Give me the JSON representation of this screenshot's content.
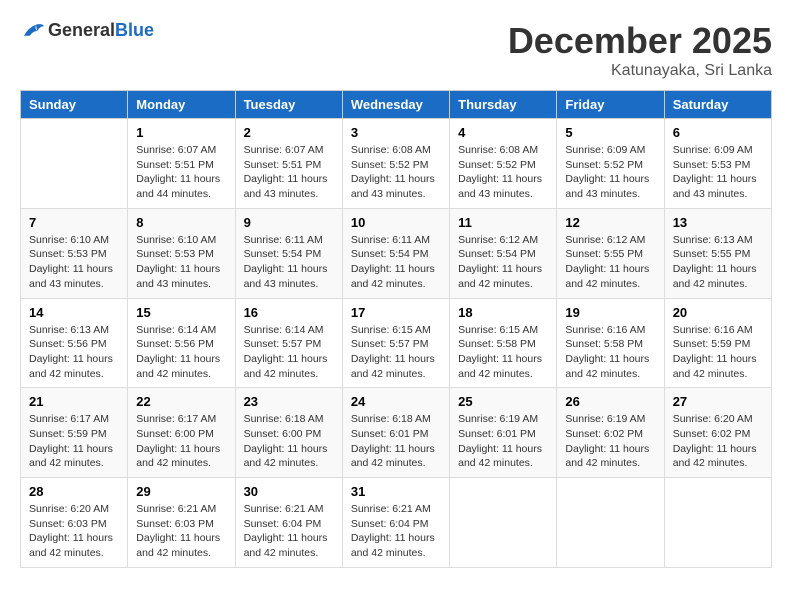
{
  "logo": {
    "general": "General",
    "blue": "Blue"
  },
  "title": "December 2025",
  "location": "Katunayaka, Sri Lanka",
  "weekdays": [
    "Sunday",
    "Monday",
    "Tuesday",
    "Wednesday",
    "Thursday",
    "Friday",
    "Saturday"
  ],
  "weeks": [
    [
      {
        "day": "",
        "info": ""
      },
      {
        "day": "1",
        "info": "Sunrise: 6:07 AM\nSunset: 5:51 PM\nDaylight: 11 hours and 44 minutes."
      },
      {
        "day": "2",
        "info": "Sunrise: 6:07 AM\nSunset: 5:51 PM\nDaylight: 11 hours and 43 minutes."
      },
      {
        "day": "3",
        "info": "Sunrise: 6:08 AM\nSunset: 5:52 PM\nDaylight: 11 hours and 43 minutes."
      },
      {
        "day": "4",
        "info": "Sunrise: 6:08 AM\nSunset: 5:52 PM\nDaylight: 11 hours and 43 minutes."
      },
      {
        "day": "5",
        "info": "Sunrise: 6:09 AM\nSunset: 5:52 PM\nDaylight: 11 hours and 43 minutes."
      },
      {
        "day": "6",
        "info": "Sunrise: 6:09 AM\nSunset: 5:53 PM\nDaylight: 11 hours and 43 minutes."
      }
    ],
    [
      {
        "day": "7",
        "info": "Sunrise: 6:10 AM\nSunset: 5:53 PM\nDaylight: 11 hours and 43 minutes."
      },
      {
        "day": "8",
        "info": "Sunrise: 6:10 AM\nSunset: 5:53 PM\nDaylight: 11 hours and 43 minutes."
      },
      {
        "day": "9",
        "info": "Sunrise: 6:11 AM\nSunset: 5:54 PM\nDaylight: 11 hours and 43 minutes."
      },
      {
        "day": "10",
        "info": "Sunrise: 6:11 AM\nSunset: 5:54 PM\nDaylight: 11 hours and 42 minutes."
      },
      {
        "day": "11",
        "info": "Sunrise: 6:12 AM\nSunset: 5:54 PM\nDaylight: 11 hours and 42 minutes."
      },
      {
        "day": "12",
        "info": "Sunrise: 6:12 AM\nSunset: 5:55 PM\nDaylight: 11 hours and 42 minutes."
      },
      {
        "day": "13",
        "info": "Sunrise: 6:13 AM\nSunset: 5:55 PM\nDaylight: 11 hours and 42 minutes."
      }
    ],
    [
      {
        "day": "14",
        "info": "Sunrise: 6:13 AM\nSunset: 5:56 PM\nDaylight: 11 hours and 42 minutes."
      },
      {
        "day": "15",
        "info": "Sunrise: 6:14 AM\nSunset: 5:56 PM\nDaylight: 11 hours and 42 minutes."
      },
      {
        "day": "16",
        "info": "Sunrise: 6:14 AM\nSunset: 5:57 PM\nDaylight: 11 hours and 42 minutes."
      },
      {
        "day": "17",
        "info": "Sunrise: 6:15 AM\nSunset: 5:57 PM\nDaylight: 11 hours and 42 minutes."
      },
      {
        "day": "18",
        "info": "Sunrise: 6:15 AM\nSunset: 5:58 PM\nDaylight: 11 hours and 42 minutes."
      },
      {
        "day": "19",
        "info": "Sunrise: 6:16 AM\nSunset: 5:58 PM\nDaylight: 11 hours and 42 minutes."
      },
      {
        "day": "20",
        "info": "Sunrise: 6:16 AM\nSunset: 5:59 PM\nDaylight: 11 hours and 42 minutes."
      }
    ],
    [
      {
        "day": "21",
        "info": "Sunrise: 6:17 AM\nSunset: 5:59 PM\nDaylight: 11 hours and 42 minutes."
      },
      {
        "day": "22",
        "info": "Sunrise: 6:17 AM\nSunset: 6:00 PM\nDaylight: 11 hours and 42 minutes."
      },
      {
        "day": "23",
        "info": "Sunrise: 6:18 AM\nSunset: 6:00 PM\nDaylight: 11 hours and 42 minutes."
      },
      {
        "day": "24",
        "info": "Sunrise: 6:18 AM\nSunset: 6:01 PM\nDaylight: 11 hours and 42 minutes."
      },
      {
        "day": "25",
        "info": "Sunrise: 6:19 AM\nSunset: 6:01 PM\nDaylight: 11 hours and 42 minutes."
      },
      {
        "day": "26",
        "info": "Sunrise: 6:19 AM\nSunset: 6:02 PM\nDaylight: 11 hours and 42 minutes."
      },
      {
        "day": "27",
        "info": "Sunrise: 6:20 AM\nSunset: 6:02 PM\nDaylight: 11 hours and 42 minutes."
      }
    ],
    [
      {
        "day": "28",
        "info": "Sunrise: 6:20 AM\nSunset: 6:03 PM\nDaylight: 11 hours and 42 minutes."
      },
      {
        "day": "29",
        "info": "Sunrise: 6:21 AM\nSunset: 6:03 PM\nDaylight: 11 hours and 42 minutes."
      },
      {
        "day": "30",
        "info": "Sunrise: 6:21 AM\nSunset: 6:04 PM\nDaylight: 11 hours and 42 minutes."
      },
      {
        "day": "31",
        "info": "Sunrise: 6:21 AM\nSunset: 6:04 PM\nDaylight: 11 hours and 42 minutes."
      },
      {
        "day": "",
        "info": ""
      },
      {
        "day": "",
        "info": ""
      },
      {
        "day": "",
        "info": ""
      }
    ]
  ]
}
